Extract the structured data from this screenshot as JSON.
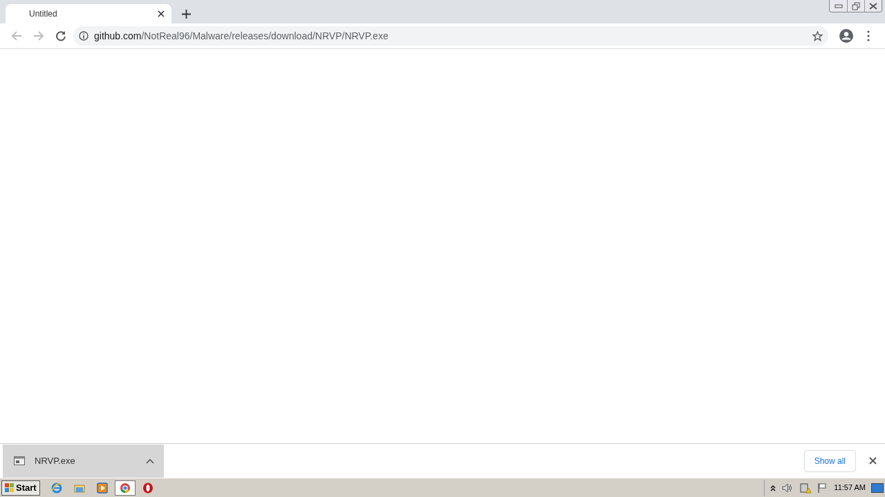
{
  "window": {
    "tab_title": "Untitled"
  },
  "address_bar": {
    "host": "github.com",
    "path": "/NotReal96/Malware/releases/download/NRVP/NRVP.exe"
  },
  "download_shelf": {
    "file_name": "NRVP.exe",
    "show_all": "Show all"
  },
  "taskbar": {
    "start": "Start",
    "apps": [
      {
        "kind": "ie",
        "selected": false
      },
      {
        "kind": "explorer",
        "selected": false
      },
      {
        "kind": "media",
        "selected": false
      },
      {
        "kind": "chrome",
        "selected": true
      },
      {
        "kind": "opera",
        "selected": false
      }
    ],
    "clock": "11:57 AM"
  }
}
